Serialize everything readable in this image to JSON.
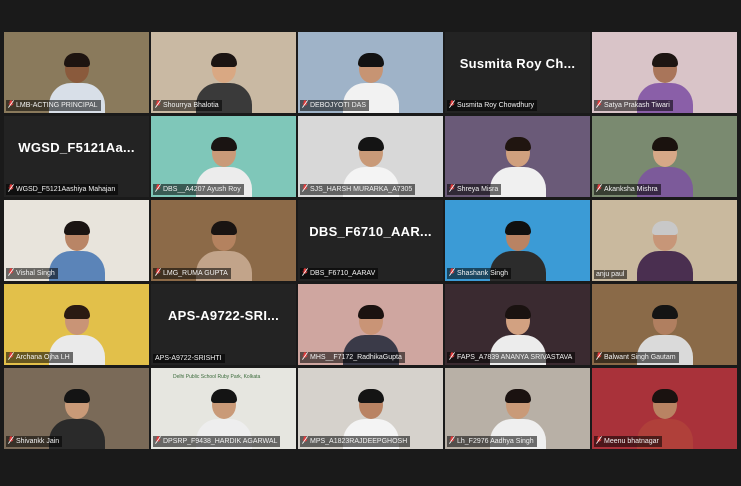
{
  "meeting": {
    "participants": [
      {
        "name": "LMB-ACTING PRINCIPAL",
        "type": "video",
        "active": true,
        "muted": true,
        "bg": "#8a7a5c",
        "skin": "#8a5a3c",
        "hair": "#1e1410",
        "shirt": "#d8dfe8"
      },
      {
        "name": "Shourrya Bhalotia",
        "type": "video",
        "muted": true,
        "bg": "#c9b9a3",
        "skin": "#d9a883",
        "hair": "#1b1412",
        "shirt": "#3a3a3a"
      },
      {
        "name": "DEBOJYOTI DAS",
        "type": "video",
        "muted": true,
        "bg": "#9fb3c8",
        "skin": "#c79473",
        "hair": "#121212",
        "shirt": "#f2f2f2"
      },
      {
        "name": "Susmita Roy Chowdhury",
        "type": "name",
        "display": "Susmita Roy Ch...",
        "muted": true
      },
      {
        "name": "Satya Prakash Tiwari",
        "type": "video",
        "muted": true,
        "bg": "#d9c4c8",
        "skin": "#a9755a",
        "hair": "#1d1512",
        "shirt": "#8a5fa8"
      },
      {
        "name": "WGSD_F5121Aashiya Mahajan",
        "type": "name",
        "display": "WGSD_F5121Aa...",
        "muted": true
      },
      {
        "name": "DBS__A4207 Ayush Roy",
        "type": "video",
        "muted": true,
        "bg": "#7fc7b9",
        "skin": "#c99a78",
        "hair": "#1a1412",
        "shirt": "#ececec"
      },
      {
        "name": "SJS_HARSH MURARKA_A7305",
        "type": "video",
        "muted": true,
        "bg": "#d8d8d8",
        "skin": "#c99a78",
        "hair": "#141414",
        "shirt": "#f4f4f4"
      },
      {
        "name": "Shreya Misra",
        "type": "video",
        "muted": true,
        "bg": "#6a5a78",
        "skin": "#d0a07e",
        "hair": "#201510",
        "shirt": "#f0f0f0"
      },
      {
        "name": "Akanksha Mishra",
        "type": "video",
        "muted": true,
        "bg": "#7a8a70",
        "skin": "#d6a887",
        "hair": "#1a120e",
        "shirt": "#7c5a9a"
      },
      {
        "name": "Vishal Singh",
        "type": "video",
        "muted": true,
        "bg": "#e8e4dc",
        "skin": "#b98566",
        "hair": "#1a1412",
        "shirt": "#5b84b8"
      },
      {
        "name": "LMG_RUMA GUPTA",
        "type": "video",
        "muted": true,
        "bg": "#8c6a48",
        "skin": "#b4825f",
        "hair": "#1a1412",
        "shirt": "#c2a48a"
      },
      {
        "name": "DBS_F6710_AARAV",
        "type": "name",
        "display": "DBS_F6710_AAR...",
        "muted": true
      },
      {
        "name": "Shashank Singh",
        "type": "video",
        "muted": true,
        "bg": "#3b9bd6",
        "skin": "#b98363",
        "hair": "#101010",
        "shirt": "#2c2c2c"
      },
      {
        "name": "anju paul",
        "type": "video",
        "muted": false,
        "bg": "#c9b99e",
        "skin": "#c79678",
        "hair": "#c8c8c8",
        "shirt": "#4a2f50"
      },
      {
        "name": "Archana Ojha LH",
        "type": "video",
        "muted": true,
        "bg": "#e2c04a",
        "skin": "#c99476",
        "hair": "#2a1a12",
        "shirt": "#eaeaea"
      },
      {
        "name": "APS-A9722-SRISHTI",
        "type": "name",
        "display": "APS-A9722-SRI...",
        "muted": false
      },
      {
        "name": "MHS__F7172_RadhikaGupta",
        "type": "video",
        "muted": true,
        "bg": "#cfa6a0",
        "skin": "#c99476",
        "hair": "#1b1210",
        "shirt": "#3a3a48"
      },
      {
        "name": "FAPS_A7839 ANANYA SRIVASTAVA",
        "type": "video",
        "muted": true,
        "bg": "#3a2a30",
        "skin": "#d2a181",
        "hair": "#1a1210",
        "shirt": "#ececec"
      },
      {
        "name": "Balwant Singh Gautam",
        "type": "video",
        "muted": true,
        "bg": "#8a6a48",
        "skin": "#b07f60",
        "hair": "#141414",
        "shirt": "#dadada"
      },
      {
        "name": "Shivankk Jain",
        "type": "video",
        "muted": true,
        "bg": "#7a6a58",
        "skin": "#c99a78",
        "hair": "#141414",
        "shirt": "#2a2a2a"
      },
      {
        "name": "DPSRP_F9438_HARDIK AGARWAL",
        "type": "video",
        "active": true,
        "muted": true,
        "bg": "#e6e6e0",
        "skin": "#c99a78",
        "hair": "#141414",
        "shirt": "#eeeeee",
        "banner": "Delhi Public School Ruby Park, Kolkata"
      },
      {
        "name": "MPS_A1823RAJDEEPGHOSH",
        "type": "video",
        "muted": true,
        "bg": "#d6d2cc",
        "skin": "#b98363",
        "hair": "#141414",
        "shirt": "#f4f4f4"
      },
      {
        "name": "Lh_F2976 Aadhya Singh",
        "type": "video",
        "muted": true,
        "bg": "#b8b0a6",
        "skin": "#c99a78",
        "hair": "#1a1210",
        "shirt": "#efefef"
      },
      {
        "name": "Meenu bhatnagar",
        "type": "video",
        "muted": true,
        "bg": "#a9323a",
        "skin": "#b98363",
        "hair": "#1a1210",
        "shirt": "#b0403a"
      }
    ]
  }
}
